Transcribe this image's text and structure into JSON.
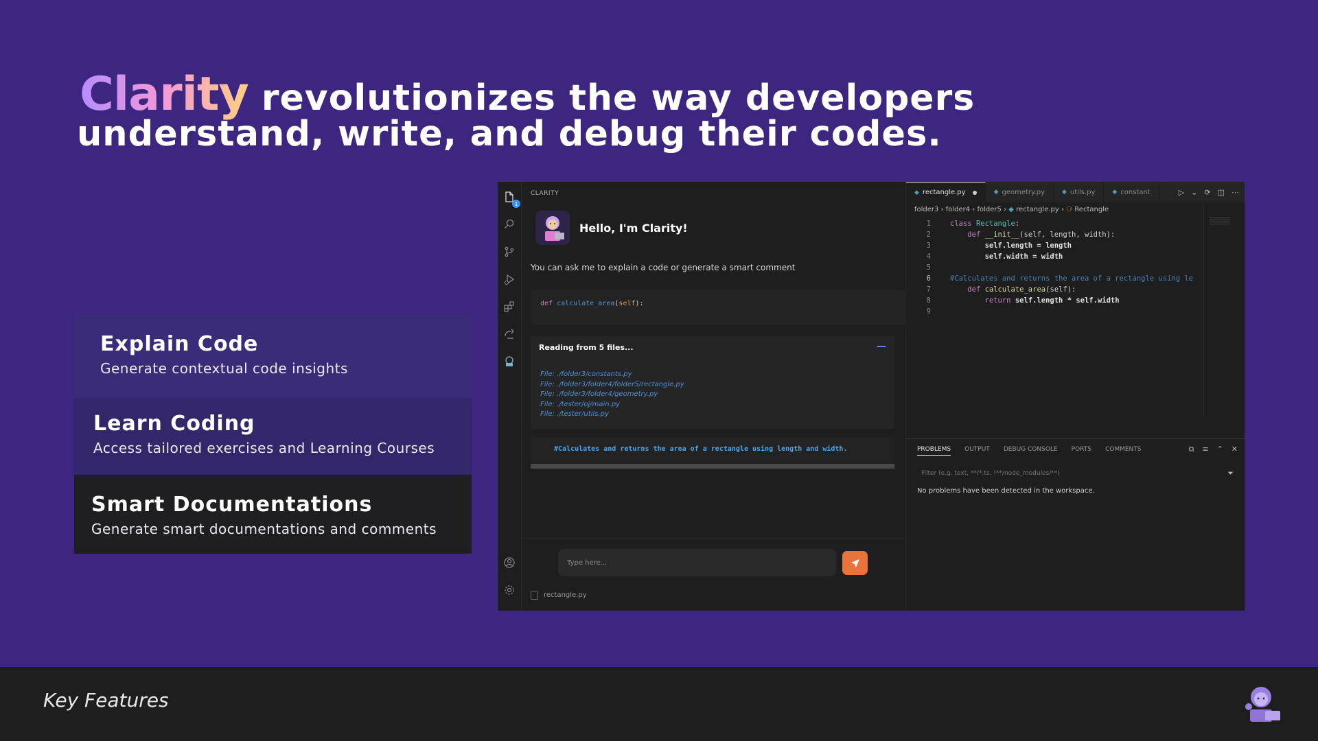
{
  "hero": {
    "brand": "Clarity",
    "line1_rest": " revolutionizes the way developers",
    "line2": "understand, write, and debug their codes."
  },
  "features": [
    {
      "title": "Explain Code",
      "desc": "Generate contextual code insights"
    },
    {
      "title": "Learn Coding",
      "desc": "Access tailored exercises and Learning Courses"
    },
    {
      "title": "Smart Documentations",
      "desc": "Generate smart documentations and comments"
    }
  ],
  "ide": {
    "activity_badge": "1",
    "chat": {
      "header": "CLARITY",
      "hello": "Hello, I'm Clarity!",
      "subtitle": "You can ask me to explain a code or generate a smart comment",
      "code_kw": "def",
      "code_fn": "calculate_area",
      "code_param": "self",
      "reading_title": "Reading from 5 files...",
      "files": [
        "File: ./folder3/constants.py",
        "File: ./folder3/folder4/folder5/rectangle.py",
        "File: ./folder3/folder4/geometry.py",
        "File: ./tester/oj/main.py",
        "File: ./tester/utils.py"
      ],
      "comment": "#Calculates and returns the area of a rectangle using length and width.",
      "input_placeholder": "Type here...",
      "file_tag": "rectangle.py"
    },
    "editor": {
      "tabs": [
        {
          "label": "rectangle.py",
          "active": true
        },
        {
          "label": "geometry.py",
          "active": false
        },
        {
          "label": "utils.py",
          "active": false
        },
        {
          "label": "constant",
          "active": false
        }
      ],
      "breadcrumb": [
        "folder3",
        "folder4",
        "folder5",
        "rectangle.py",
        "Rectangle"
      ],
      "line_numbers": [
        "1",
        "2",
        "3",
        "4",
        "5",
        "6",
        "7",
        "8",
        "9"
      ],
      "code_lines": {
        "l1_kw": "class",
        "l1_name": "Rectangle",
        "l2_kw": "def",
        "l2_fn": "__init__",
        "l2_args": "self, length, width",
        "l3": "self.length = length",
        "l4": "self.width = width",
        "l6": "#Calculates and returns the area of a rectangle using le",
        "l7_kw": "def",
        "l7_fn": "calculate_area",
        "l7_args": "self",
        "l8_kw": "return",
        "l8": "self.length * self.width"
      }
    },
    "panel": {
      "tabs": [
        "PROBLEMS",
        "OUTPUT",
        "DEBUG CONSOLE",
        "PORTS",
        "COMMENTS"
      ],
      "filter_placeholder": "Filter (e.g. text, **/*.ts, !**/node_modules/**)",
      "message": "No problems have been detected in the workspace."
    }
  },
  "footer": {
    "label": "Key Features"
  },
  "colors": {
    "background": "#3d2680",
    "accent_send": "#e8743b",
    "footer": "#1e1e1f"
  }
}
